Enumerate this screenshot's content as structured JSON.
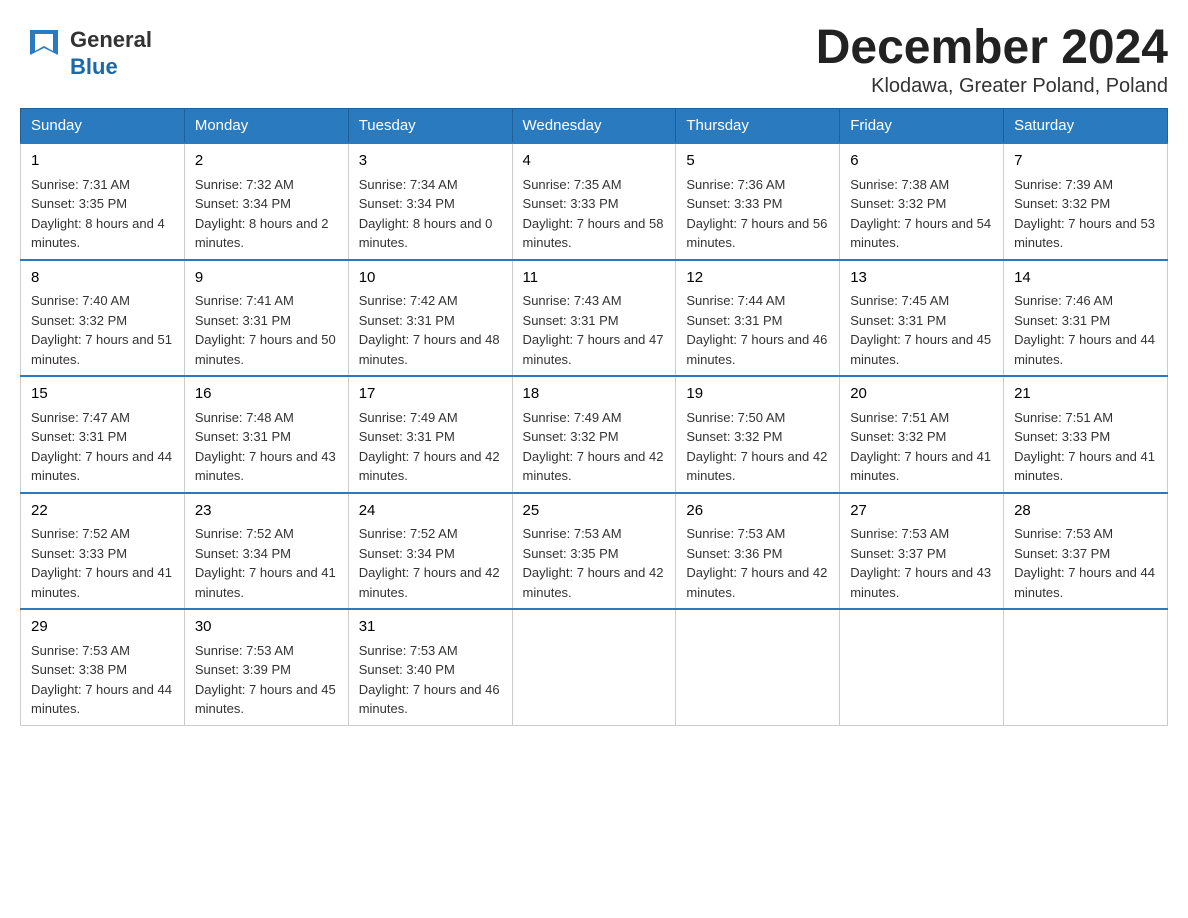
{
  "header": {
    "logo_general": "General",
    "logo_blue": "Blue",
    "month_title": "December 2024",
    "location": "Klodawa, Greater Poland, Poland"
  },
  "days_of_week": [
    "Sunday",
    "Monday",
    "Tuesday",
    "Wednesday",
    "Thursday",
    "Friday",
    "Saturday"
  ],
  "weeks": [
    [
      {
        "day": "1",
        "sunrise": "7:31 AM",
        "sunset": "3:35 PM",
        "daylight": "8 hours and 4 minutes."
      },
      {
        "day": "2",
        "sunrise": "7:32 AM",
        "sunset": "3:34 PM",
        "daylight": "8 hours and 2 minutes."
      },
      {
        "day": "3",
        "sunrise": "7:34 AM",
        "sunset": "3:34 PM",
        "daylight": "8 hours and 0 minutes."
      },
      {
        "day": "4",
        "sunrise": "7:35 AM",
        "sunset": "3:33 PM",
        "daylight": "7 hours and 58 minutes."
      },
      {
        "day": "5",
        "sunrise": "7:36 AM",
        "sunset": "3:33 PM",
        "daylight": "7 hours and 56 minutes."
      },
      {
        "day": "6",
        "sunrise": "7:38 AM",
        "sunset": "3:32 PM",
        "daylight": "7 hours and 54 minutes."
      },
      {
        "day": "7",
        "sunrise": "7:39 AM",
        "sunset": "3:32 PM",
        "daylight": "7 hours and 53 minutes."
      }
    ],
    [
      {
        "day": "8",
        "sunrise": "7:40 AM",
        "sunset": "3:32 PM",
        "daylight": "7 hours and 51 minutes."
      },
      {
        "day": "9",
        "sunrise": "7:41 AM",
        "sunset": "3:31 PM",
        "daylight": "7 hours and 50 minutes."
      },
      {
        "day": "10",
        "sunrise": "7:42 AM",
        "sunset": "3:31 PM",
        "daylight": "7 hours and 48 minutes."
      },
      {
        "day": "11",
        "sunrise": "7:43 AM",
        "sunset": "3:31 PM",
        "daylight": "7 hours and 47 minutes."
      },
      {
        "day": "12",
        "sunrise": "7:44 AM",
        "sunset": "3:31 PM",
        "daylight": "7 hours and 46 minutes."
      },
      {
        "day": "13",
        "sunrise": "7:45 AM",
        "sunset": "3:31 PM",
        "daylight": "7 hours and 45 minutes."
      },
      {
        "day": "14",
        "sunrise": "7:46 AM",
        "sunset": "3:31 PM",
        "daylight": "7 hours and 44 minutes."
      }
    ],
    [
      {
        "day": "15",
        "sunrise": "7:47 AM",
        "sunset": "3:31 PM",
        "daylight": "7 hours and 44 minutes."
      },
      {
        "day": "16",
        "sunrise": "7:48 AM",
        "sunset": "3:31 PM",
        "daylight": "7 hours and 43 minutes."
      },
      {
        "day": "17",
        "sunrise": "7:49 AM",
        "sunset": "3:31 PM",
        "daylight": "7 hours and 42 minutes."
      },
      {
        "day": "18",
        "sunrise": "7:49 AM",
        "sunset": "3:32 PM",
        "daylight": "7 hours and 42 minutes."
      },
      {
        "day": "19",
        "sunrise": "7:50 AM",
        "sunset": "3:32 PM",
        "daylight": "7 hours and 42 minutes."
      },
      {
        "day": "20",
        "sunrise": "7:51 AM",
        "sunset": "3:32 PM",
        "daylight": "7 hours and 41 minutes."
      },
      {
        "day": "21",
        "sunrise": "7:51 AM",
        "sunset": "3:33 PM",
        "daylight": "7 hours and 41 minutes."
      }
    ],
    [
      {
        "day": "22",
        "sunrise": "7:52 AM",
        "sunset": "3:33 PM",
        "daylight": "7 hours and 41 minutes."
      },
      {
        "day": "23",
        "sunrise": "7:52 AM",
        "sunset": "3:34 PM",
        "daylight": "7 hours and 41 minutes."
      },
      {
        "day": "24",
        "sunrise": "7:52 AM",
        "sunset": "3:34 PM",
        "daylight": "7 hours and 42 minutes."
      },
      {
        "day": "25",
        "sunrise": "7:53 AM",
        "sunset": "3:35 PM",
        "daylight": "7 hours and 42 minutes."
      },
      {
        "day": "26",
        "sunrise": "7:53 AM",
        "sunset": "3:36 PM",
        "daylight": "7 hours and 42 minutes."
      },
      {
        "day": "27",
        "sunrise": "7:53 AM",
        "sunset": "3:37 PM",
        "daylight": "7 hours and 43 minutes."
      },
      {
        "day": "28",
        "sunrise": "7:53 AM",
        "sunset": "3:37 PM",
        "daylight": "7 hours and 44 minutes."
      }
    ],
    [
      {
        "day": "29",
        "sunrise": "7:53 AM",
        "sunset": "3:38 PM",
        "daylight": "7 hours and 44 minutes."
      },
      {
        "day": "30",
        "sunrise": "7:53 AM",
        "sunset": "3:39 PM",
        "daylight": "7 hours and 45 minutes."
      },
      {
        "day": "31",
        "sunrise": "7:53 AM",
        "sunset": "3:40 PM",
        "daylight": "7 hours and 46 minutes."
      },
      null,
      null,
      null,
      null
    ]
  ],
  "labels": {
    "sunrise": "Sunrise:",
    "sunset": "Sunset:",
    "daylight": "Daylight:"
  }
}
